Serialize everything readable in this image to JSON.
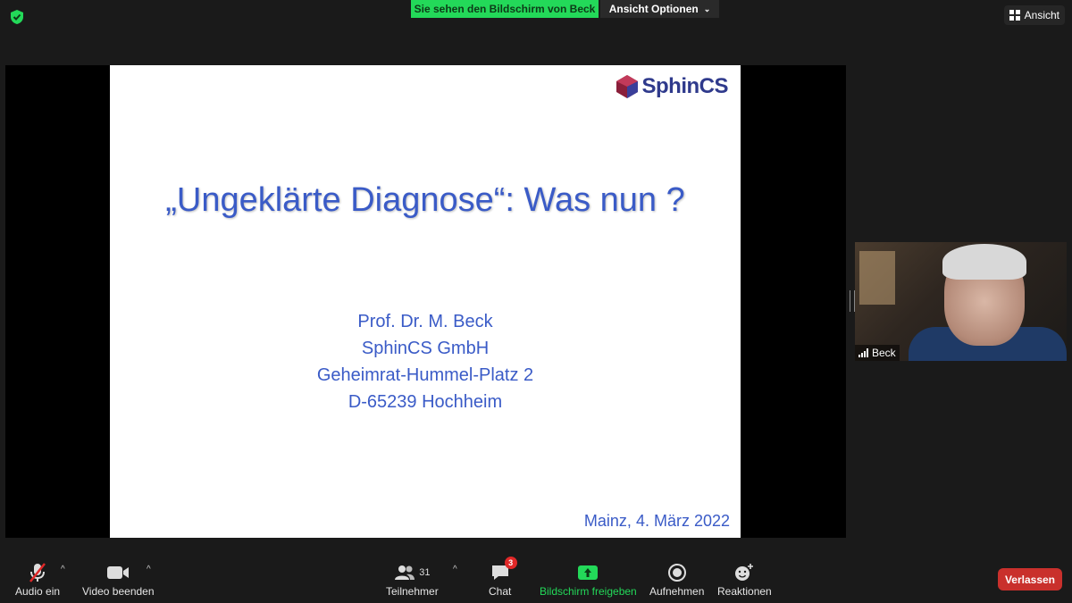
{
  "topbar": {
    "share_banner": "Sie sehen den Bildschirm von Beck",
    "view_options": "Ansicht Optionen",
    "view_button": "Ansicht"
  },
  "slide": {
    "logo_text": "SphinCS",
    "title": "„Ungeklärte Diagnose“: Was nun ?",
    "author_lines": [
      "Prof. Dr. M. Beck",
      "SphinCS GmbH",
      "Geheimrat-Hummel-Platz 2",
      "D-65239 Hochheim"
    ],
    "date": "Mainz, 4. März 2022"
  },
  "participant": {
    "name": "Beck"
  },
  "toolbar": {
    "audio_label": "Audio ein",
    "video_label": "Video beenden",
    "participants_label": "Teilnehmer",
    "participants_count": "31",
    "chat_label": "Chat",
    "chat_badge": "3",
    "share_label": "Bildschirm freigeben",
    "record_label": "Aufnehmen",
    "reactions_label": "Reaktionen",
    "leave_label": "Verlassen"
  },
  "colors": {
    "share_green": "#23d959",
    "slide_text": "#3a5bc7",
    "leave_red": "#c9302c"
  }
}
